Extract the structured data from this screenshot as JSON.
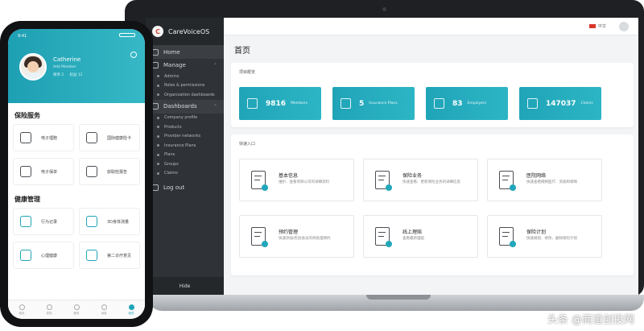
{
  "laptop": {
    "app_name": "CareVoiceOS",
    "brand_logo_letter": "C",
    "sidebar": {
      "items": [
        {
          "label": "Home"
        },
        {
          "label": "Manage"
        },
        {
          "label": "Admins"
        },
        {
          "label": "Roles & permissions"
        },
        {
          "label": "Organization dashboards"
        },
        {
          "label": "Dashboards"
        },
        {
          "label": "Company profile"
        },
        {
          "label": "Products"
        },
        {
          "label": "Provider networks"
        },
        {
          "label": "Insurance Plans"
        },
        {
          "label": "Plans"
        },
        {
          "label": "Groups"
        },
        {
          "label": "Claims"
        },
        {
          "label": "Log out"
        }
      ],
      "hide_label": "Hide"
    },
    "topbar": {
      "language": "中文"
    },
    "page_title": "首页",
    "overview": {
      "title": "项目概览",
      "stats": [
        {
          "value": "9816",
          "label": "Members"
        },
        {
          "value": "5",
          "label": "Insurance Plans"
        },
        {
          "value": "83",
          "label": "Employers"
        },
        {
          "value": "147037",
          "label": "Claims"
        }
      ]
    },
    "quick": {
      "title": "快速入口",
      "cards": [
        {
          "title": "基本信息",
          "desc": "维护、查看项目公司的详细资料"
        },
        {
          "title": "保险业务",
          "desc": "快速查看、更新保险业务的详细信息"
        },
        {
          "title": "医院网络",
          "desc": "快速查看网络医疗、资质和保障"
        },
        {
          "title": "预约管理",
          "desc": "快速添加/检验会员的待处理预约"
        },
        {
          "title": "线上理赔",
          "desc": "查看最新理赔"
        },
        {
          "title": "保险计划",
          "desc": "快速规划、修改、删除保险计划"
        }
      ]
    }
  },
  "phone": {
    "status_time": "9:41",
    "user_name": "Catherine",
    "user_sub": "Add Member",
    "user_meta_left": "保单 2",
    "user_meta_right": "权益 12",
    "sections": [
      {
        "title": "保险服务",
        "tiles": [
          {
            "label": "电子理赔"
          },
          {
            "label": "国际健康险卡"
          },
          {
            "label": "电子保单"
          },
          {
            "label": "获取检报告"
          }
        ]
      },
      {
        "title": "健康管理",
        "tiles": [
          {
            "label": "行为记录"
          },
          {
            "label": "3D身体测量"
          },
          {
            "label": "心理健康"
          },
          {
            "label": "第二诊疗意见"
          }
        ]
      }
    ],
    "tabs": [
      {
        "label": "首页"
      },
      {
        "label": "发现"
      },
      {
        "label": "服务"
      },
      {
        "label": "消息"
      },
      {
        "label": "我的"
      }
    ]
  },
  "watermark": "头条 @商道创投网",
  "colors": {
    "accent": "#22a7ba",
    "sidebar": "#2f3236"
  }
}
